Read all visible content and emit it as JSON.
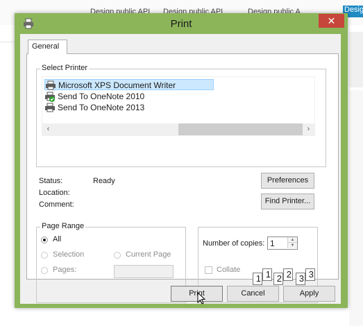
{
  "background": {
    "tabs": [
      "Design public API",
      "Design public API",
      "Design public A"
    ],
    "blue_tab": "Desig"
  },
  "dialog": {
    "title": "Print",
    "close_icon": "close-icon",
    "tabs": [
      "General"
    ],
    "select_printer": {
      "heading": "Select Printer",
      "printers": [
        {
          "name": "Microsoft XPS Document Writer",
          "selected": true
        },
        {
          "name": "Send To OneNote 2010",
          "selected": false
        },
        {
          "name": "Send To OneNote 2013",
          "selected": false
        }
      ],
      "scroll_left": "‹",
      "scroll_right": "›"
    },
    "status": {
      "status_label": "Status:",
      "status_value": "Ready",
      "location_label": "Location:",
      "location_value": "",
      "comment_label": "Comment:",
      "comment_value": "",
      "preferences_button": "Preferences",
      "find_printer_button": "Find Printer..."
    },
    "page_range": {
      "heading": "Page Range",
      "all": "All",
      "selection": "Selection",
      "current_page": "Current Page",
      "pages": "Pages:",
      "pages_value": "",
      "selected_option": "All"
    },
    "copies": {
      "label": "Number of copies:",
      "value": "1",
      "collate_label": "Collate",
      "collate_checked": false,
      "collate_pages": [
        "1",
        "1",
        "2",
        "2",
        "3",
        "3"
      ]
    },
    "buttons": {
      "print": "Print",
      "cancel": "Cancel",
      "apply": "Apply"
    }
  }
}
